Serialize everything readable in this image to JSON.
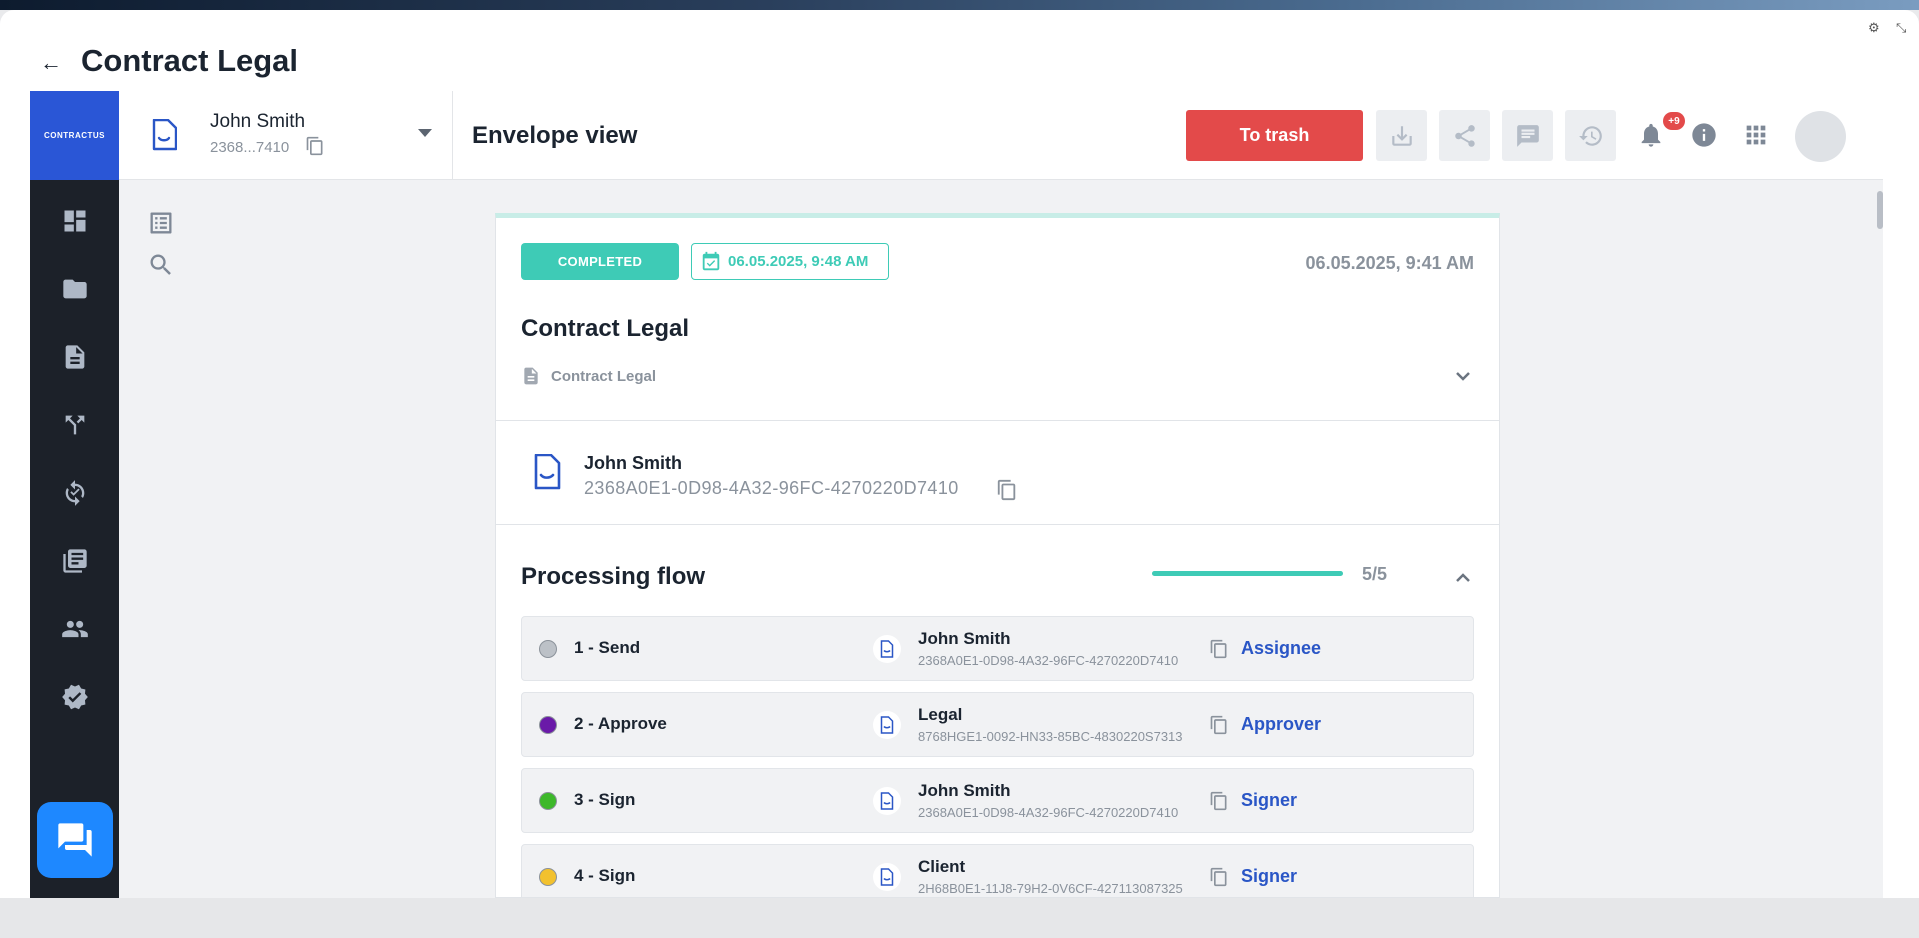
{
  "window": {
    "title": "Contract Legal"
  },
  "sidebar": {
    "logo_text": "CONTRACTUS",
    "items": [
      {
        "icon": "dashboard-icon"
      },
      {
        "icon": "folder-icon"
      },
      {
        "icon": "document-icon"
      },
      {
        "icon": "workflow-icon"
      },
      {
        "icon": "sync-check-icon"
      },
      {
        "icon": "library-icon"
      },
      {
        "icon": "contacts-icon"
      },
      {
        "icon": "verified-badge-icon"
      }
    ],
    "chat_icon": "chat-icon"
  },
  "account": {
    "name": "John Smith",
    "short_id": "2368...7410"
  },
  "toolbar": {
    "title": "Envelope view",
    "trash_label": "To trash",
    "notifications_badge": "+9",
    "colors": {
      "trash": "#e34a4a"
    }
  },
  "envelope": {
    "status": "COMPLETED",
    "status_color": "#3ecbb6",
    "completed_date": "06.05.2025, 9:48 AM",
    "created_date": "06.05.2025, 9:41 AM",
    "title": "Contract Legal",
    "document_name": "Contract Legal",
    "sender": {
      "name": "John Smith",
      "id": "2368A0E1-0D98-4A32-96FC-4270220D7410"
    }
  },
  "flow": {
    "title": "Processing flow",
    "progress_text": "5/5",
    "progress_fraction": 1.0,
    "steps": [
      {
        "label": "1 - Send",
        "dot_color": "#bcc1c7",
        "participant": "John Smith",
        "id": "2368A0E1-0D98-4A32-96FC-4270220D7410",
        "role": "Assignee"
      },
      {
        "label": "2 - Approve",
        "dot_color": "#6a1aa8",
        "participant": "Legal",
        "id": "8768HGE1-0092-HN33-85BC-4830220S7313",
        "role": "Approver"
      },
      {
        "label": "3 - Sign",
        "dot_color": "#3db82a",
        "participant": "John Smith",
        "id": "2368A0E1-0D98-4A32-96FC-4270220D7410",
        "role": "Signer"
      },
      {
        "label": "4 - Sign",
        "dot_color": "#f2c12e",
        "participant": "Client",
        "id": "2H68B0E1-11J8-79H2-0V6CF-427113087325",
        "role": "Signer"
      }
    ]
  }
}
